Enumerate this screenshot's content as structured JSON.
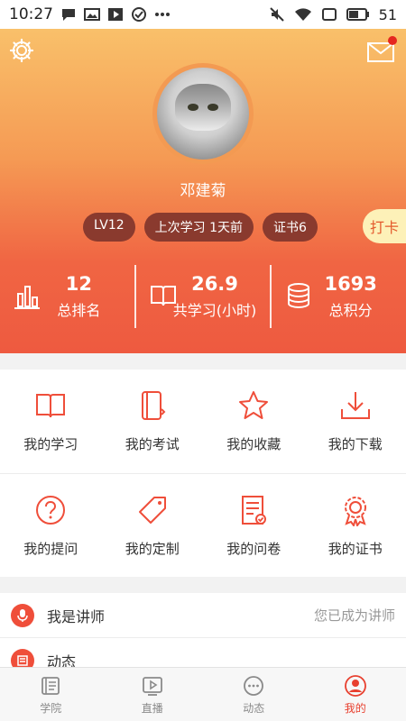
{
  "status_bar": {
    "time": "10:27",
    "battery": "51"
  },
  "profile": {
    "name": "邓建菊",
    "tags": [
      "LV12",
      "上次学习  1天前",
      "证书6"
    ],
    "checkin_label": "打卡"
  },
  "stats": [
    {
      "value": "12",
      "label": "总排名"
    },
    {
      "value": "26.9",
      "label": "共学习(小时)"
    },
    {
      "value": "1693",
      "label": "总积分"
    }
  ],
  "grid": [
    {
      "label": "我的学习",
      "icon": "book-icon"
    },
    {
      "label": "我的考试",
      "icon": "exam-icon"
    },
    {
      "label": "我的收藏",
      "icon": "star-icon"
    },
    {
      "label": "我的下载",
      "icon": "download-icon"
    },
    {
      "label": "我的提问",
      "icon": "question-icon"
    },
    {
      "label": "我的定制",
      "icon": "tag-icon"
    },
    {
      "label": "我的问卷",
      "icon": "survey-icon"
    },
    {
      "label": "我的证书",
      "icon": "certificate-icon"
    }
  ],
  "list": [
    {
      "label": "我是讲师",
      "right": "您已成为讲师"
    },
    {
      "label": "动态",
      "right": ""
    }
  ],
  "tabs": [
    {
      "label": "学院",
      "active": false
    },
    {
      "label": "直播",
      "active": false
    },
    {
      "label": "动态",
      "active": false
    },
    {
      "label": "我的",
      "active": true
    }
  ],
  "colors": {
    "accent": "#ef4e3a",
    "tag_bg": "#8a3a2e",
    "checkin_bg": "#fdf1b8"
  }
}
